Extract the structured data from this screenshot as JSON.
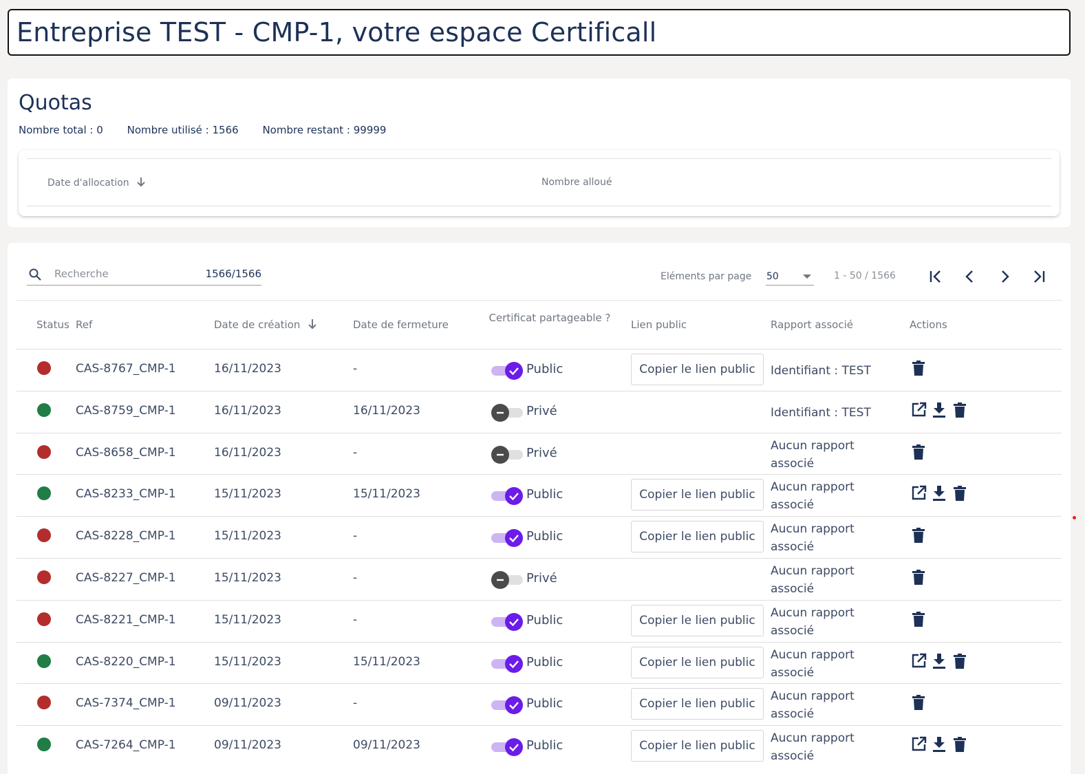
{
  "header": {
    "title": "Entreprise TEST - CMP-1, votre espace Certificall"
  },
  "quotas": {
    "title": "Quotas",
    "total": "Nombre total : 0",
    "used": "Nombre utilisé : 1566",
    "remaining": "Nombre restant : 99999",
    "columns": {
      "date": "Date d'allocation",
      "amount": "Nombre alloué"
    }
  },
  "toolbar": {
    "search_placeholder": "Recherche",
    "search_count": "1566/1566",
    "per_page_label": "Eléments par page",
    "per_page_value": "50",
    "range": "1 - 50 / 1566"
  },
  "table": {
    "columns": {
      "status": "Status",
      "ref": "Ref",
      "created": "Date de création",
      "closed": "Date de fermeture",
      "shareable": "Certificat partageable ?",
      "link": "Lien public",
      "report": "Rapport associé",
      "actions": "Actions"
    },
    "copy_label": "Copier le lien public",
    "rows": [
      {
        "status": "red",
        "ref": "CAS-8767_CMP-1",
        "created": "16/11/2023",
        "closed": "-",
        "public": true,
        "share_label": "Public",
        "report": "Identifiant : TEST",
        "actions": [
          "delete"
        ]
      },
      {
        "status": "green",
        "ref": "CAS-8759_CMP-1",
        "created": "16/11/2023",
        "closed": "16/11/2023",
        "public": false,
        "share_label": "Privé",
        "report": "Identifiant : TEST",
        "actions": [
          "open",
          "download",
          "delete"
        ]
      },
      {
        "status": "red",
        "ref": "CAS-8658_CMP-1",
        "created": "16/11/2023",
        "closed": "-",
        "public": false,
        "share_label": "Privé",
        "report": "Aucun rapport associé",
        "actions": [
          "delete"
        ]
      },
      {
        "status": "green",
        "ref": "CAS-8233_CMP-1",
        "created": "15/11/2023",
        "closed": "15/11/2023",
        "public": true,
        "share_label": "Public",
        "report": "Aucun rapport associé",
        "actions": [
          "open",
          "download",
          "delete"
        ]
      },
      {
        "status": "red",
        "ref": "CAS-8228_CMP-1",
        "created": "15/11/2023",
        "closed": "-",
        "public": true,
        "share_label": "Public",
        "report": "Aucun rapport associé",
        "actions": [
          "delete"
        ]
      },
      {
        "status": "red",
        "ref": "CAS-8227_CMP-1",
        "created": "15/11/2023",
        "closed": "-",
        "public": false,
        "share_label": "Privé",
        "report": "Aucun rapport associé",
        "actions": [
          "delete"
        ]
      },
      {
        "status": "red",
        "ref": "CAS-8221_CMP-1",
        "created": "15/11/2023",
        "closed": "-",
        "public": true,
        "share_label": "Public",
        "report": "Aucun rapport associé",
        "actions": [
          "delete"
        ]
      },
      {
        "status": "green",
        "ref": "CAS-8220_CMP-1",
        "created": "15/11/2023",
        "closed": "15/11/2023",
        "public": true,
        "share_label": "Public",
        "report": "Aucun rapport associé",
        "actions": [
          "open",
          "download",
          "delete"
        ]
      },
      {
        "status": "red",
        "ref": "CAS-7374_CMP-1",
        "created": "09/11/2023",
        "closed": "-",
        "public": true,
        "share_label": "Public",
        "report": "Aucun rapport associé",
        "actions": [
          "delete"
        ]
      },
      {
        "status": "green",
        "ref": "CAS-7264_CMP-1",
        "created": "09/11/2023",
        "closed": "09/11/2023",
        "public": true,
        "share_label": "Public",
        "report": "Aucun rapport associé",
        "actions": [
          "open",
          "download",
          "delete"
        ]
      }
    ]
  },
  "colors": {
    "status_red": "#b32d2d",
    "status_green": "#1f7d45",
    "toggle_on": "#6b1ce8",
    "toggle_on_track": "#cdb4f3",
    "text_primary": "#1d3157",
    "icon": "#1d3157"
  },
  "icons": {
    "search": "search-icon",
    "sort": "arrow-down-icon",
    "first": "first-page-icon",
    "prev": "chevron-left-icon",
    "next": "chevron-right-icon",
    "last": "last-page-icon",
    "open": "open-in-new-icon",
    "download": "download-icon",
    "delete": "trash-icon"
  }
}
